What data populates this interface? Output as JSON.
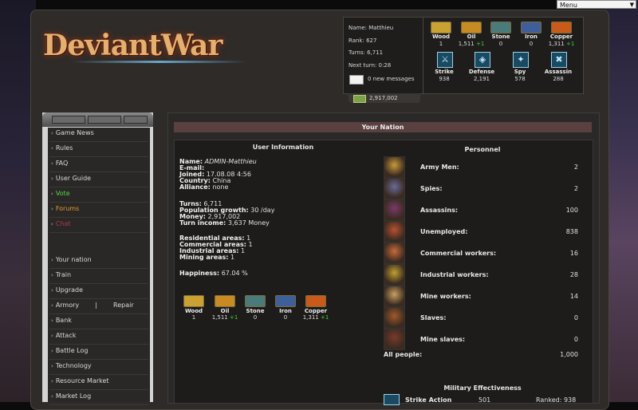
{
  "menu": {
    "label": "Menu"
  },
  "logo": {
    "text": "DeviantWar"
  },
  "user": {
    "name_label": "Name:",
    "name": "Matthieu",
    "rank": "Rank: 627",
    "turns": "Turns: 6,711",
    "next_turn": "Next turn: 0:28",
    "messages": "0 new messages",
    "money": "2,917,002"
  },
  "resources": [
    {
      "name": "Wood",
      "value": "1",
      "bonus": "",
      "color": "#c9a233"
    },
    {
      "name": "Oil",
      "value": "1,511",
      "bonus": "+1",
      "color": "#c88a22"
    },
    {
      "name": "Stone",
      "value": "0",
      "bonus": "",
      "color": "#4a7a7a"
    },
    {
      "name": "Iron",
      "value": "0",
      "bonus": "",
      "color": "#3f5f9a"
    },
    {
      "name": "Copper",
      "value": "1,311",
      "bonus": "+1",
      "color": "#c85a1a"
    }
  ],
  "skills": [
    {
      "name": "Strike",
      "value": "938",
      "icon": "strike-icon"
    },
    {
      "name": "Defense",
      "value": "2,191",
      "icon": "defense-icon"
    },
    {
      "name": "Spy",
      "value": "578",
      "icon": "spy-icon"
    },
    {
      "name": "Assassin",
      "value": "288",
      "icon": "assassin-icon"
    }
  ],
  "nav": {
    "items1": [
      {
        "label": "Game News",
        "color": "#d9d9d9"
      },
      {
        "label": "Rules",
        "color": "#d9d9d9"
      },
      {
        "label": "FAQ",
        "color": "#d9d9d9"
      },
      {
        "label": "User Guide",
        "color": "#d9d9d9"
      },
      {
        "label": "Vote",
        "color": "#54d84a"
      },
      {
        "label": "Forums",
        "color": "#e59a2a"
      },
      {
        "label": "Chat",
        "color": "#b0374a"
      }
    ],
    "items2": [
      {
        "label": "Your nation"
      },
      {
        "label": "Train"
      },
      {
        "label": "Upgrade"
      },
      {
        "label": "Armory"
      },
      {
        "label": "Bank"
      },
      {
        "label": "Attack"
      },
      {
        "label": "Battle Log"
      },
      {
        "label": "Technology"
      },
      {
        "label": "Resource Market"
      },
      {
        "label": "Market Log"
      }
    ],
    "repair": "Repair",
    "divider": "|"
  },
  "page": {
    "title": "Your Nation",
    "user_info_title": "User Information",
    "personnel_title": "Personnel",
    "military_title": "Military Effectiveness"
  },
  "info": {
    "name_label": "Name:",
    "name_value": "ADMIN-Matthieu",
    "email_label": "E-mail:",
    "joined_label": "Joined:",
    "joined_value": "17.08.08 4:56",
    "country_label": "Country:",
    "country_value": "China",
    "alliance_label": "Alliance:",
    "alliance_value": "none",
    "turns_label": "Turns:",
    "turns_value": "6,711",
    "growth_label": "Population growth:",
    "growth_value": "30 /day",
    "money_label": "Money:",
    "money_value": "2,917,002",
    "income_label": "Turn income:",
    "income_value": "3,637 Money",
    "res_label": "Residential areas:",
    "res_value": "1",
    "com_label": "Commercial areas:",
    "com_value": "1",
    "ind_label": "Industrial areas:",
    "ind_value": "1",
    "min_label": "Mining areas:",
    "min_value": "1",
    "happy_label": "Happiness:",
    "happy_value": "67.04 %"
  },
  "personnel": [
    {
      "label": "Army Men:",
      "value": "2",
      "color": "#c79a3a"
    },
    {
      "label": "Spies:",
      "value": "2",
      "color": "#6a6a9a"
    },
    {
      "label": "Assassins:",
      "value": "100",
      "color": "#7a3a6a"
    },
    {
      "label": "Unemployed:",
      "value": "838",
      "color": "#b85030"
    },
    {
      "label": "Commercial workers:",
      "value": "16",
      "color": "#c86a3a"
    },
    {
      "label": "Industrial workers:",
      "value": "28",
      "color": "#c0a030"
    },
    {
      "label": "Mine workers:",
      "value": "14",
      "color": "#c8a060"
    },
    {
      "label": "Slaves:",
      "value": "0",
      "color": "#a05a2a"
    },
    {
      "label": "Mine slaves:",
      "value": "0",
      "color": "#7a3a2a"
    }
  ],
  "all_people": {
    "label": "All people:",
    "value": "1,000"
  },
  "military": {
    "row_label": "Strike Action",
    "value": "501",
    "ranked": "Ranked: 938"
  }
}
